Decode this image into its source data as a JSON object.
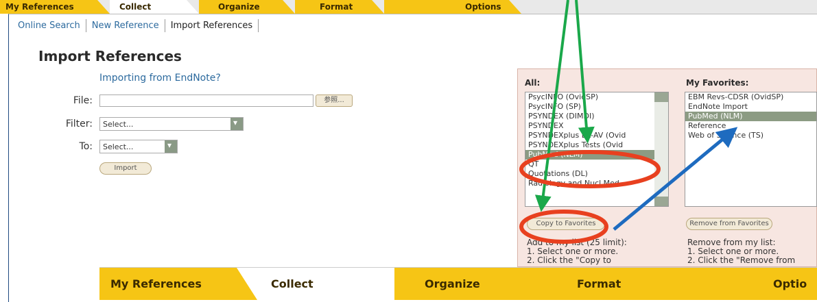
{
  "top_tabs": [
    {
      "label": "My References"
    },
    {
      "label": "Collect"
    },
    {
      "label": "Organize"
    },
    {
      "label": "Format"
    },
    {
      "label": "Options"
    }
  ],
  "subnav": [
    "Online Search",
    "New Reference",
    "Import References"
  ],
  "page": {
    "title": "Import References",
    "endnote_link": "Importing from EndNote?",
    "file_label": "File:",
    "browse_button": "参照...",
    "filter_label": "Filter:",
    "filter_value": "Select...",
    "to_label": "To:",
    "to_value": "Select...",
    "import_button": "Import"
  },
  "all_panel": {
    "title": "All:",
    "items": [
      "PsycINFO (OvidSP)",
      "PsycINFO (SP)",
      "PSYNDEX (DIMDI)",
      "PSYNDEX",
      "PSYNDEXplus Lit-AV (Ovid",
      "PSYNDEXplus Tests (Ovid",
      "PubMed (NLM)",
      "QT",
      "Quotations (DL)",
      "Radiology and Nucl Med"
    ],
    "selected_index": 6,
    "copy_button": "Copy to Favorites",
    "help_lines": [
      "Add to my list (25 limit):",
      "1. Select one or more.",
      "2. Click the \"Copy to"
    ]
  },
  "fav_panel": {
    "title": "My Favorites:",
    "items": [
      "EBM Revs-CDSR (OvidSP)",
      "EndNote Import",
      "PubMed (NLM)",
      "Reference",
      "Web of Science (TS)"
    ],
    "selected_index": 2,
    "remove_button": "Remove from Favorites",
    "help_lines": [
      "Remove from my list:",
      "1. Select one or more.",
      "2. Click the \"Remove from"
    ]
  },
  "bottom_tabs": [
    {
      "label": "My References"
    },
    {
      "label": "Collect"
    },
    {
      "label": "Organize"
    },
    {
      "label": "Format"
    },
    {
      "label": "Optio"
    }
  ],
  "colors": {
    "tab_yellow": "#f6c515",
    "arrow_green": "#1aa84a",
    "arrow_blue": "#1e6bbf",
    "highlight_red": "#e8401f"
  }
}
